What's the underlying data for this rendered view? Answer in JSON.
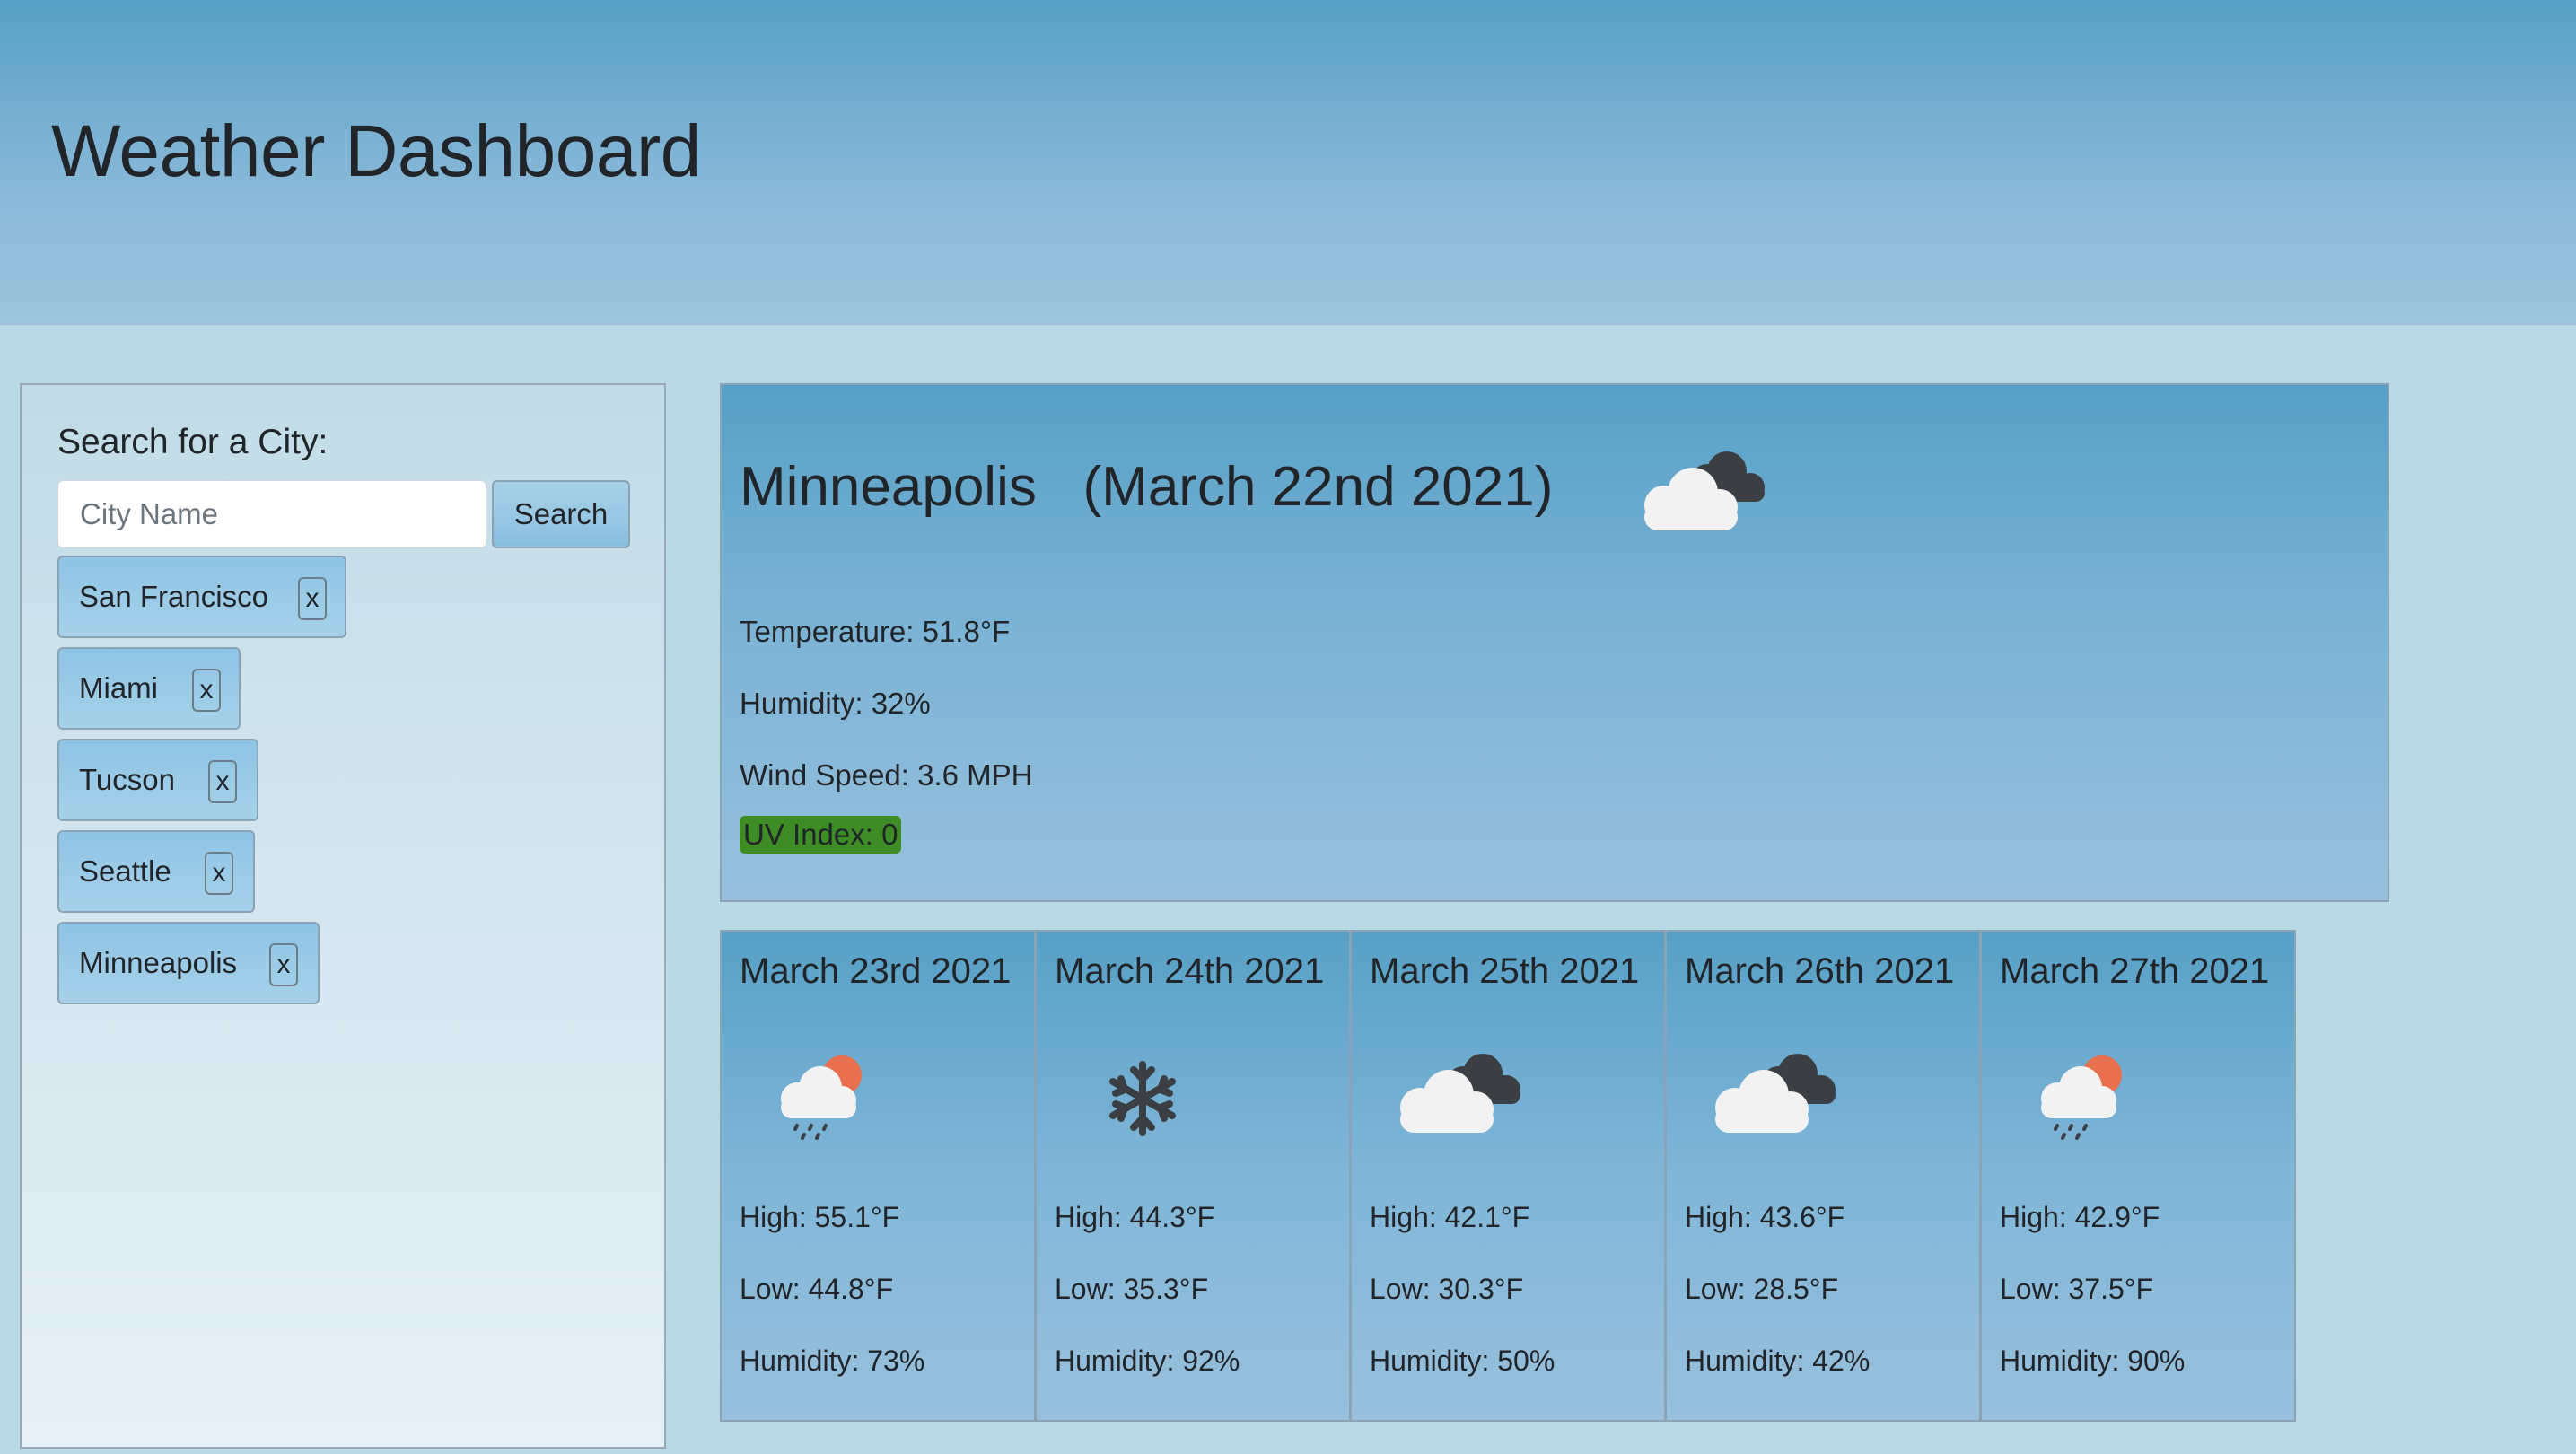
{
  "header": {
    "title": "Weather Dashboard"
  },
  "sidebar": {
    "title": "Search for a City:",
    "search_placeholder": "City Name",
    "search_label": "Search",
    "cities": [
      {
        "name": "San Francisco",
        "remove": "x"
      },
      {
        "name": "Miami",
        "remove": "x"
      },
      {
        "name": "Tucson",
        "remove": "x"
      },
      {
        "name": "Seattle",
        "remove": "x"
      },
      {
        "name": "Minneapolis",
        "remove": "x"
      }
    ]
  },
  "current": {
    "title": "Minneapolis   (March 22nd 2021)",
    "icon": "cloudy-icon",
    "temperature": "Temperature: 51.8°F",
    "humidity": "Humidity: 32%",
    "wind": "Wind Speed: 3.6 MPH",
    "uv": "UV Index: 0",
    "uv_color": "#3d8c26"
  },
  "forecast": [
    {
      "date": "March 23rd 2021",
      "icon": "rain-sun-icon",
      "high": "High: 55.1°F",
      "low": "Low: 44.8°F",
      "humidity": "Humidity: 73%"
    },
    {
      "date": "March 24th 2021",
      "icon": "snowflake-icon",
      "high": "High: 44.3°F",
      "low": "Low: 35.3°F",
      "humidity": "Humidity: 92%"
    },
    {
      "date": "March 25th 2021",
      "icon": "cloudy-icon",
      "high": "High: 42.1°F",
      "low": "Low: 30.3°F",
      "humidity": "Humidity: 50%"
    },
    {
      "date": "March 26th 2021",
      "icon": "cloudy-icon",
      "high": "High: 43.6°F",
      "low": "Low: 28.5°F",
      "humidity": "Humidity: 42%"
    },
    {
      "date": "March 27th 2021",
      "icon": "rain-sun-icon",
      "high": "High: 42.9°F",
      "low": "Low: 37.5°F",
      "humidity": "Humidity: 90%"
    }
  ]
}
